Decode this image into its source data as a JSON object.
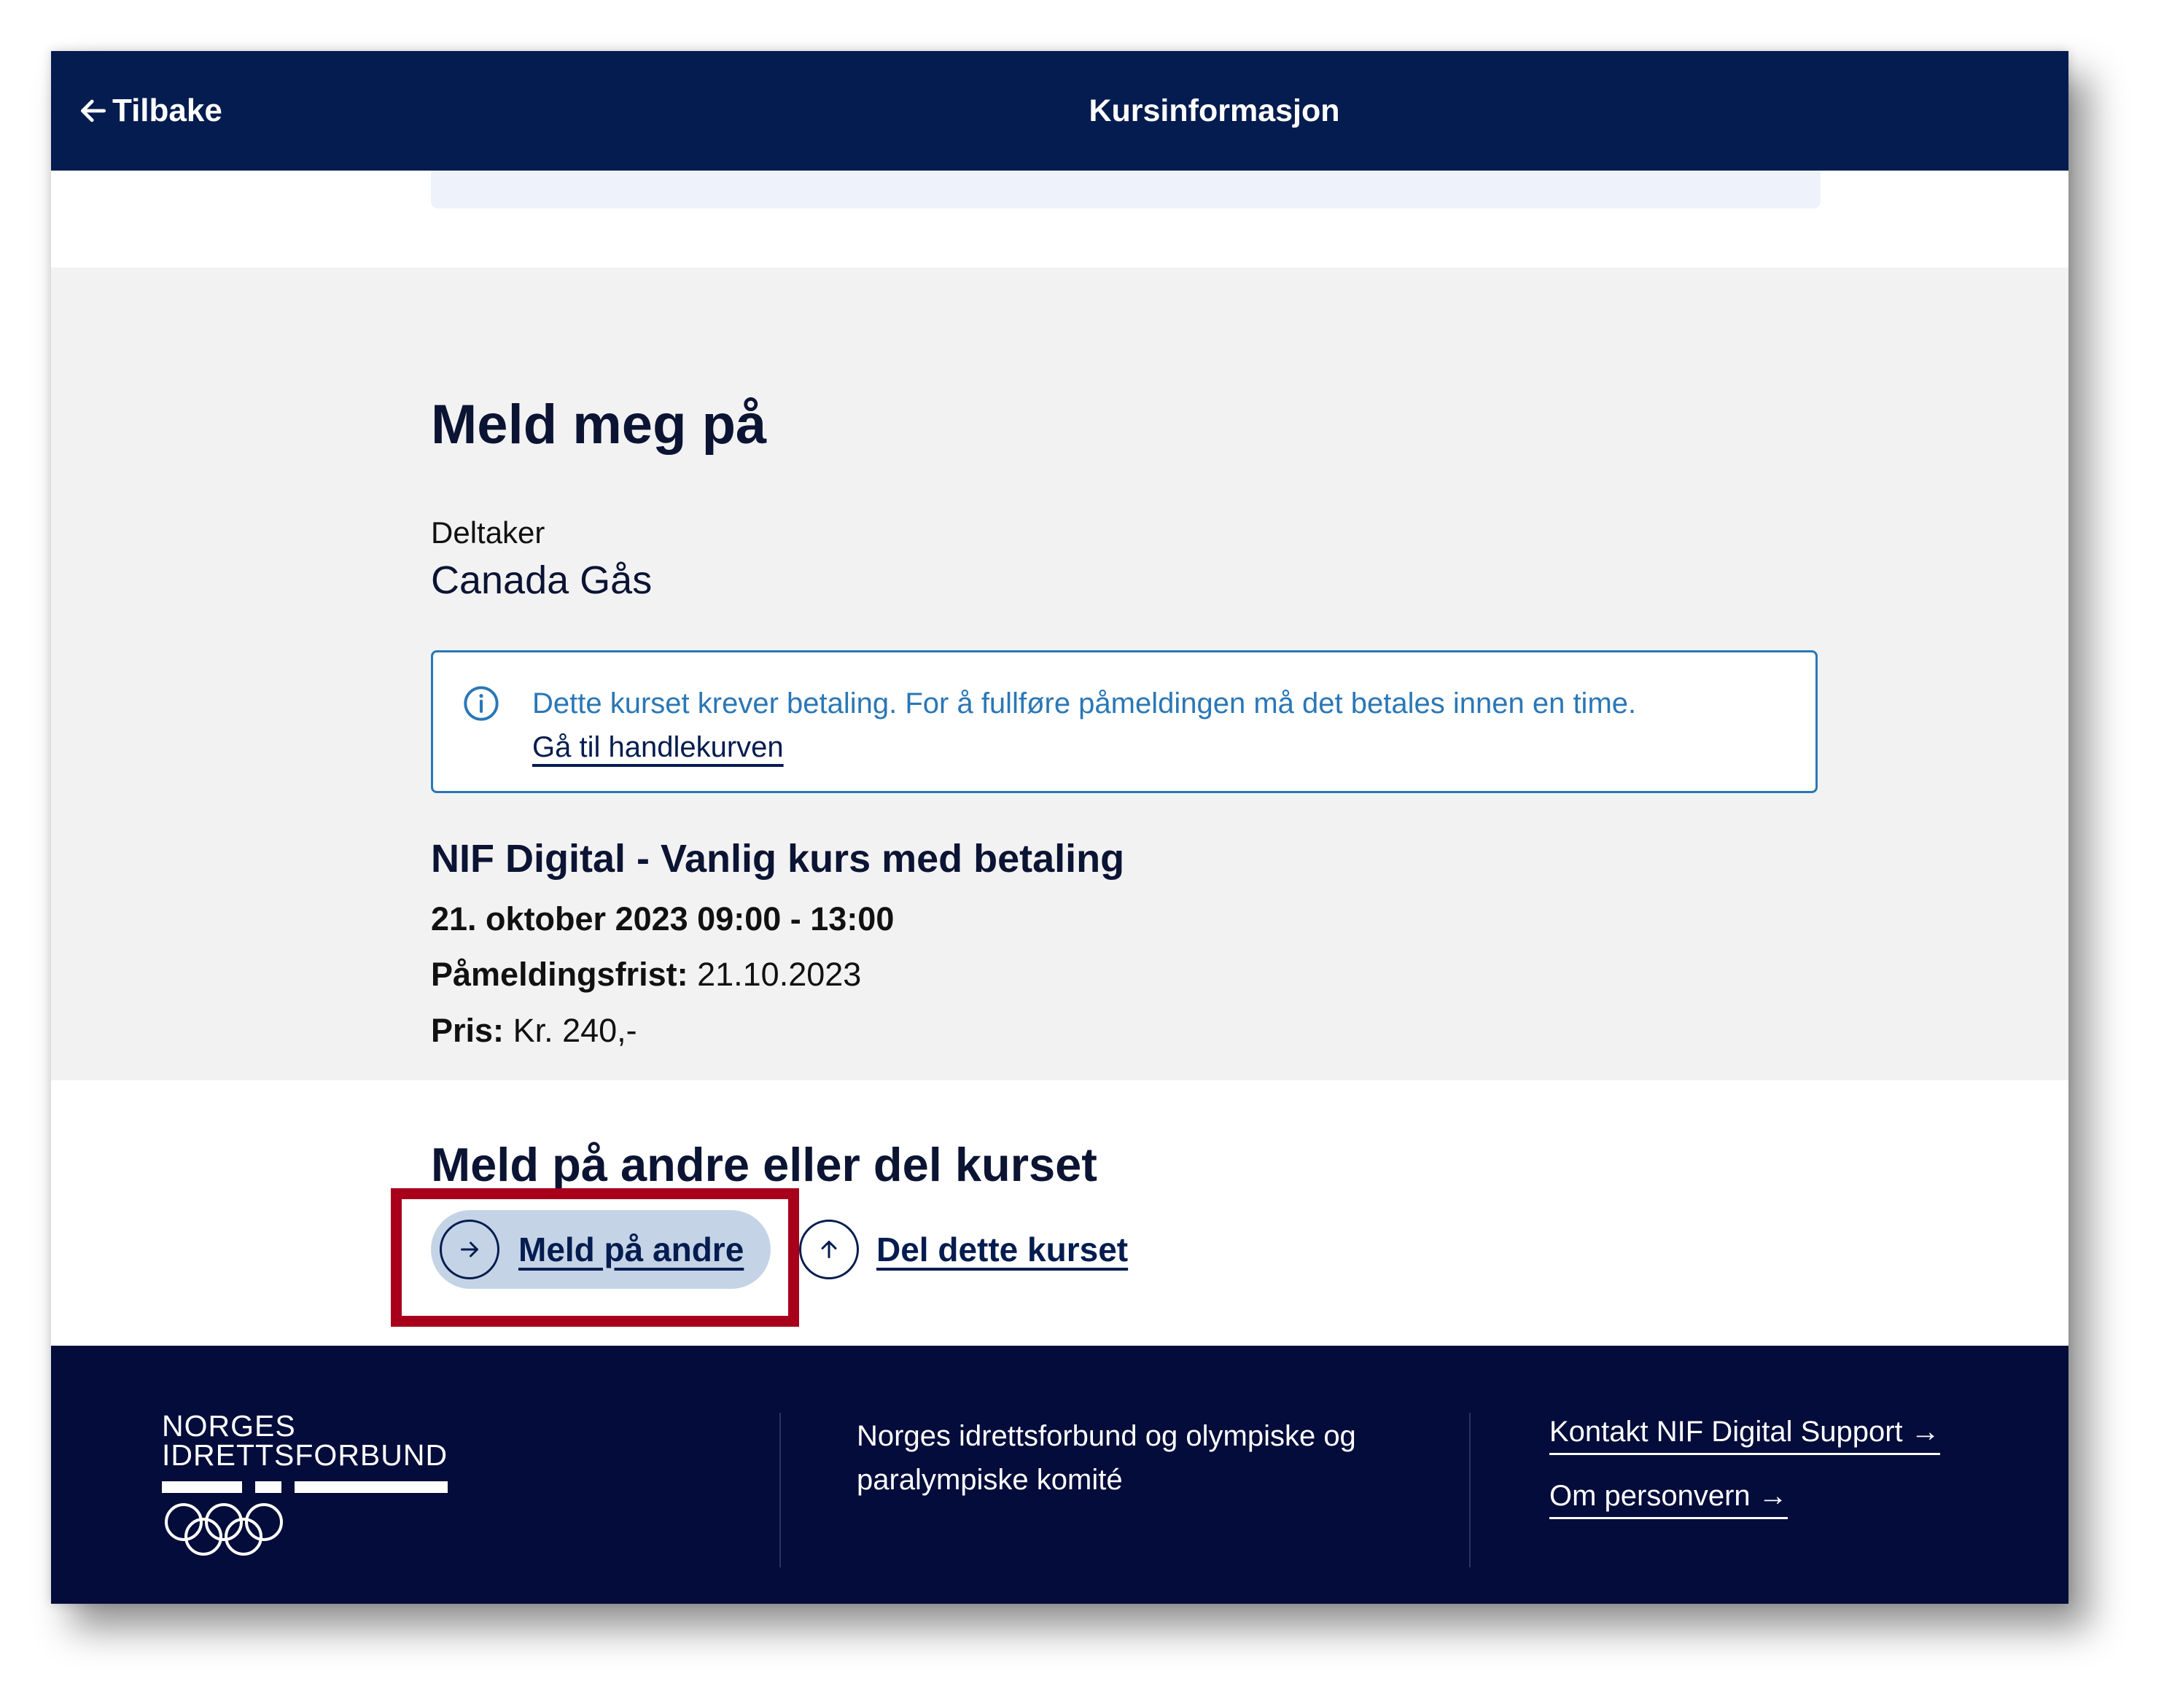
{
  "header": {
    "back_label": "Tilbake",
    "title": "Kursinformasjon"
  },
  "signup": {
    "heading": "Meld meg på",
    "participant_label": "Deltaker",
    "participant_name": "Canada Gås",
    "info_text": "Dette kurset krever betaling. For å fullføre påmeldingen må det betales innen en time. ",
    "info_link": "Gå til handlekurven",
    "course_title": "NIF Digital - Vanlig kurs med betaling",
    "course_datetime": "21. oktober 2023 09:00 - 13:00",
    "deadline_label": "Påmeldingsfrist:",
    "deadline_value": "21.10.2023",
    "price_label": "Pris:",
    "price_value": "Kr. 240,-"
  },
  "share": {
    "heading": "Meld på andre eller del kurset",
    "signup_others_label": "Meld på andre",
    "share_label": "Del dette kurset"
  },
  "footer": {
    "logo_line1": "NORGES",
    "logo_line2": "IDRETTSFORBUND",
    "org_text": "Norges idrettsforbund og olympiske og paralympiske komité",
    "link_support": "Kontakt NIF Digital Support →",
    "link_privacy": "Om personvern →"
  },
  "colors": {
    "header_bg": "#041c4f",
    "footer_bg": "#030c3a",
    "info_blue": "#2a77b6",
    "highlight_red": "#a8001b",
    "button_bg": "#c4d4e6"
  }
}
